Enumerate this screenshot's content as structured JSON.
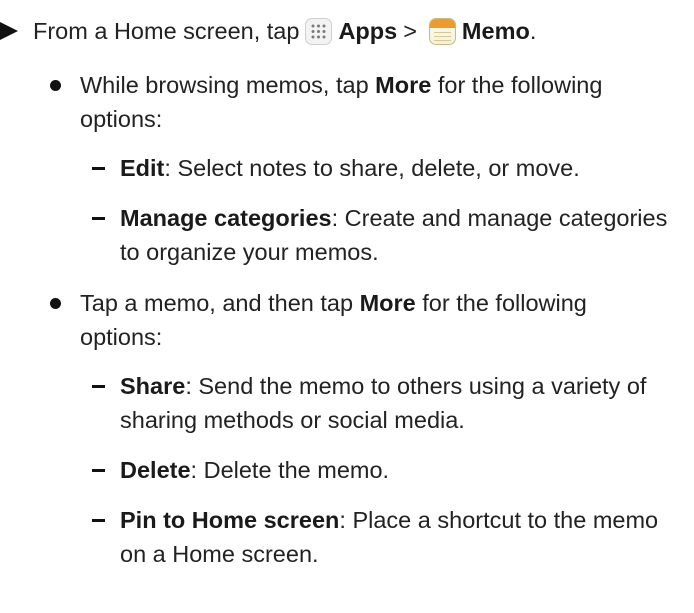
{
  "step": {
    "prefix": "From a Home screen, tap",
    "apps_label": "Apps",
    "separator": ">",
    "memo_label": "Memo",
    "end": ".",
    "apps_icon": "apps-grid-icon",
    "memo_icon": "memo-app-icon"
  },
  "bullets": [
    {
      "pre": "While browsing memos, tap ",
      "bold": "More",
      "post": " for the following options:",
      "items": [
        {
          "term": "Edit",
          "desc": ": Select notes to share, delete, or move."
        },
        {
          "term": "Manage categories",
          "desc": ": Create and manage categories to organize your memos."
        }
      ]
    },
    {
      "pre": "Tap a memo, and then tap ",
      "bold": "More",
      "post": " for the following options:",
      "items": [
        {
          "term": "Share",
          "desc": ": Send the memo to others using a variety of sharing methods or social media."
        },
        {
          "term": "Delete",
          "desc": ": Delete the memo."
        },
        {
          "term": "Pin to Home screen",
          "desc": ": Place a shortcut to the memo on a Home screen."
        }
      ]
    }
  ]
}
